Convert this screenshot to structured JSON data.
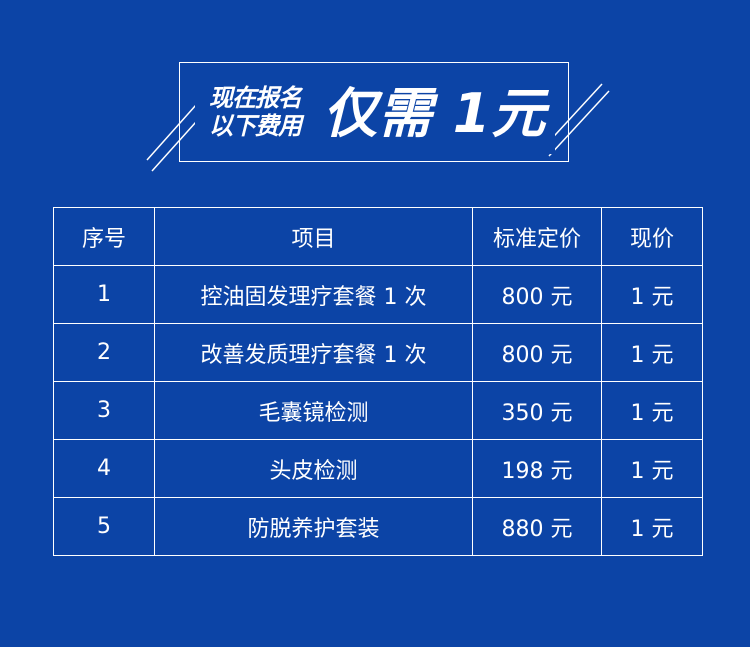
{
  "banner": {
    "line1": "现在报名",
    "line2": "以下费用",
    "highlight": "仅需 1元"
  },
  "table": {
    "headers": [
      "序号",
      "项目",
      "标准定价",
      "现价"
    ],
    "rows": [
      [
        "1",
        "控油固发理疗套餐 1 次",
        "800 元",
        "1 元"
      ],
      [
        "2",
        "改善发质理疗套餐 1 次",
        "800 元",
        "1 元"
      ],
      [
        "3",
        "毛囊镜检测",
        "350 元",
        "1 元"
      ],
      [
        "4",
        "头皮检测",
        "198 元",
        "1 元"
      ],
      [
        "5",
        "防脱养护套装",
        "880 元",
        "1 元"
      ]
    ]
  },
  "colors": {
    "background": "#0c44a6",
    "foreground": "#ffffff"
  }
}
